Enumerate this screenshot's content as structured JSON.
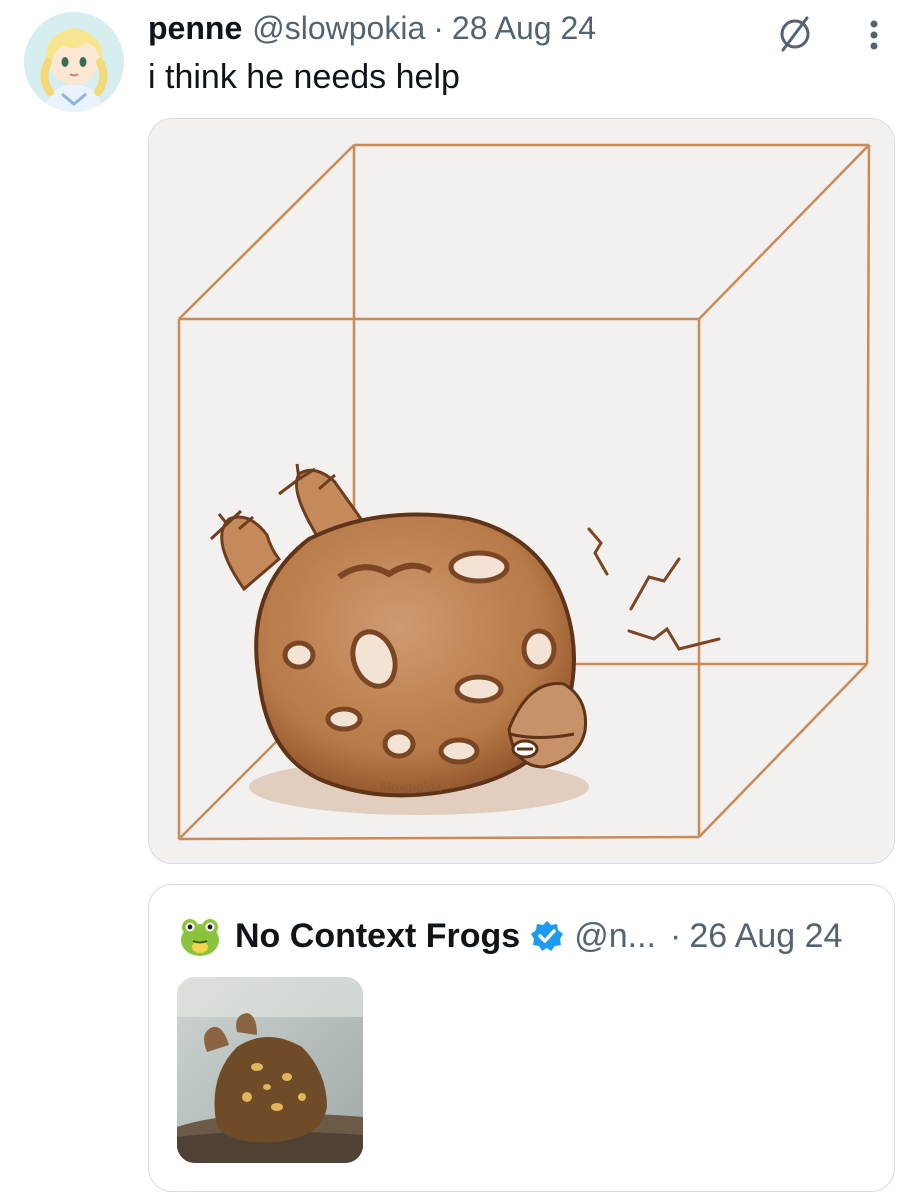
{
  "tweet": {
    "display_name": "penne",
    "handle": "@slowpokia",
    "separator": "·",
    "date": "28 Aug 24",
    "text": "i think he needs help",
    "media_signature": "Slowpokia"
  },
  "quoted": {
    "display_name": "No Context Frogs",
    "handle": "@n...",
    "separator": "·",
    "date": "26 Aug 24"
  },
  "colors": {
    "text_primary": "#0f1419",
    "text_secondary": "#536471",
    "border": "#d6dde1",
    "verified": "#1d9bf0",
    "sketch_sepia": "#b06e3b"
  },
  "icons": {
    "no_sign": "no-sign-icon",
    "more": "more-vertical-icon",
    "verified": "verified-badge-icon"
  }
}
